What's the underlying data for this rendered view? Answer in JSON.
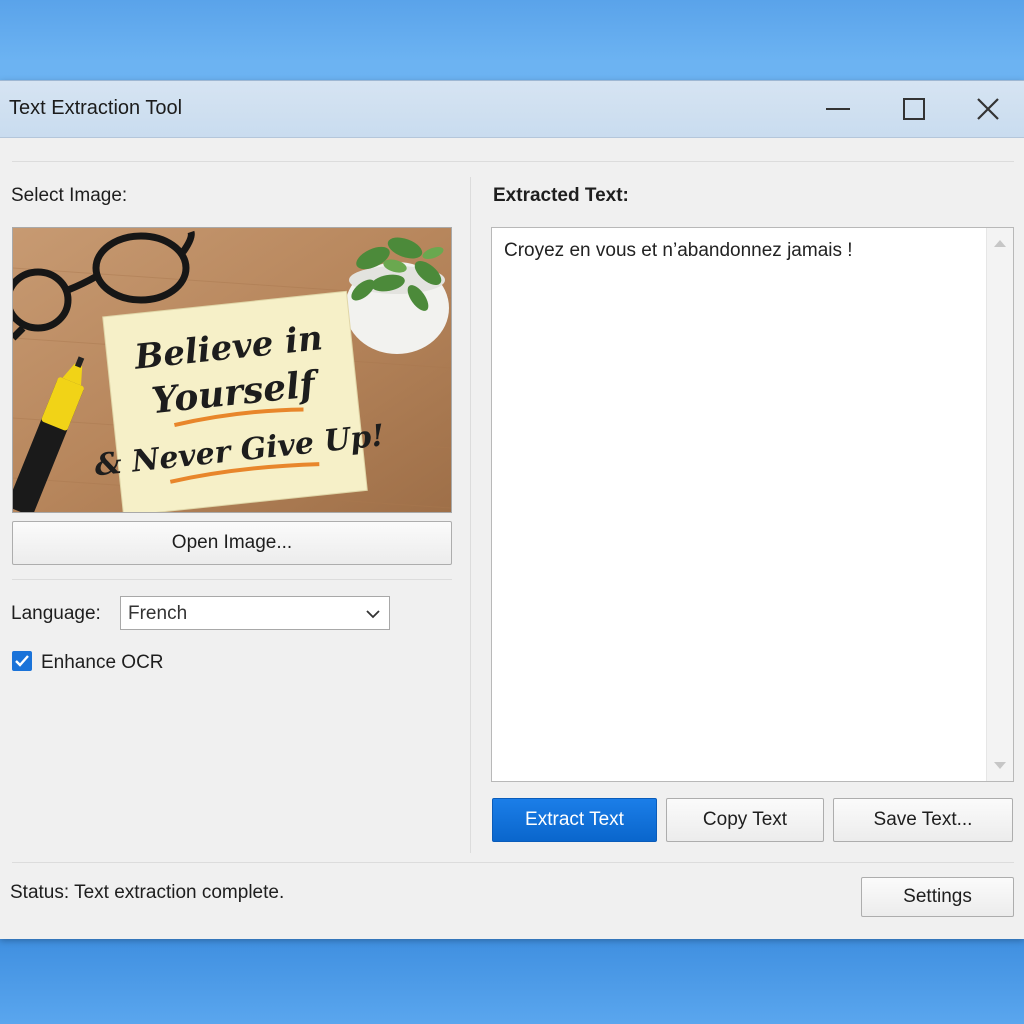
{
  "window": {
    "title": "Text Extraction Tool"
  },
  "left_panel": {
    "select_image_label": "Select Image:",
    "image_note": {
      "line1": "Believe in",
      "line2": "Yourself",
      "line3": "& Never Give Up!"
    },
    "open_image_button": "Open Image...",
    "language_label": "Language:",
    "language_value": "French",
    "enhance_ocr_label": "Enhance OCR",
    "enhance_ocr_checked": true
  },
  "right_panel": {
    "extracted_label": "Extracted Text:",
    "extracted_text": "Croyez en vous et n’abandonnez jamais !",
    "extract_button": "Extract Text",
    "copy_button": "Copy Text",
    "save_button": "Save Text..."
  },
  "footer": {
    "status": "Status: Text extraction complete.",
    "settings_button": "Settings"
  },
  "colors": {
    "accent": "#0a66cc",
    "checkbox": "#1a73d9",
    "desktop": "#5aa3ea"
  }
}
